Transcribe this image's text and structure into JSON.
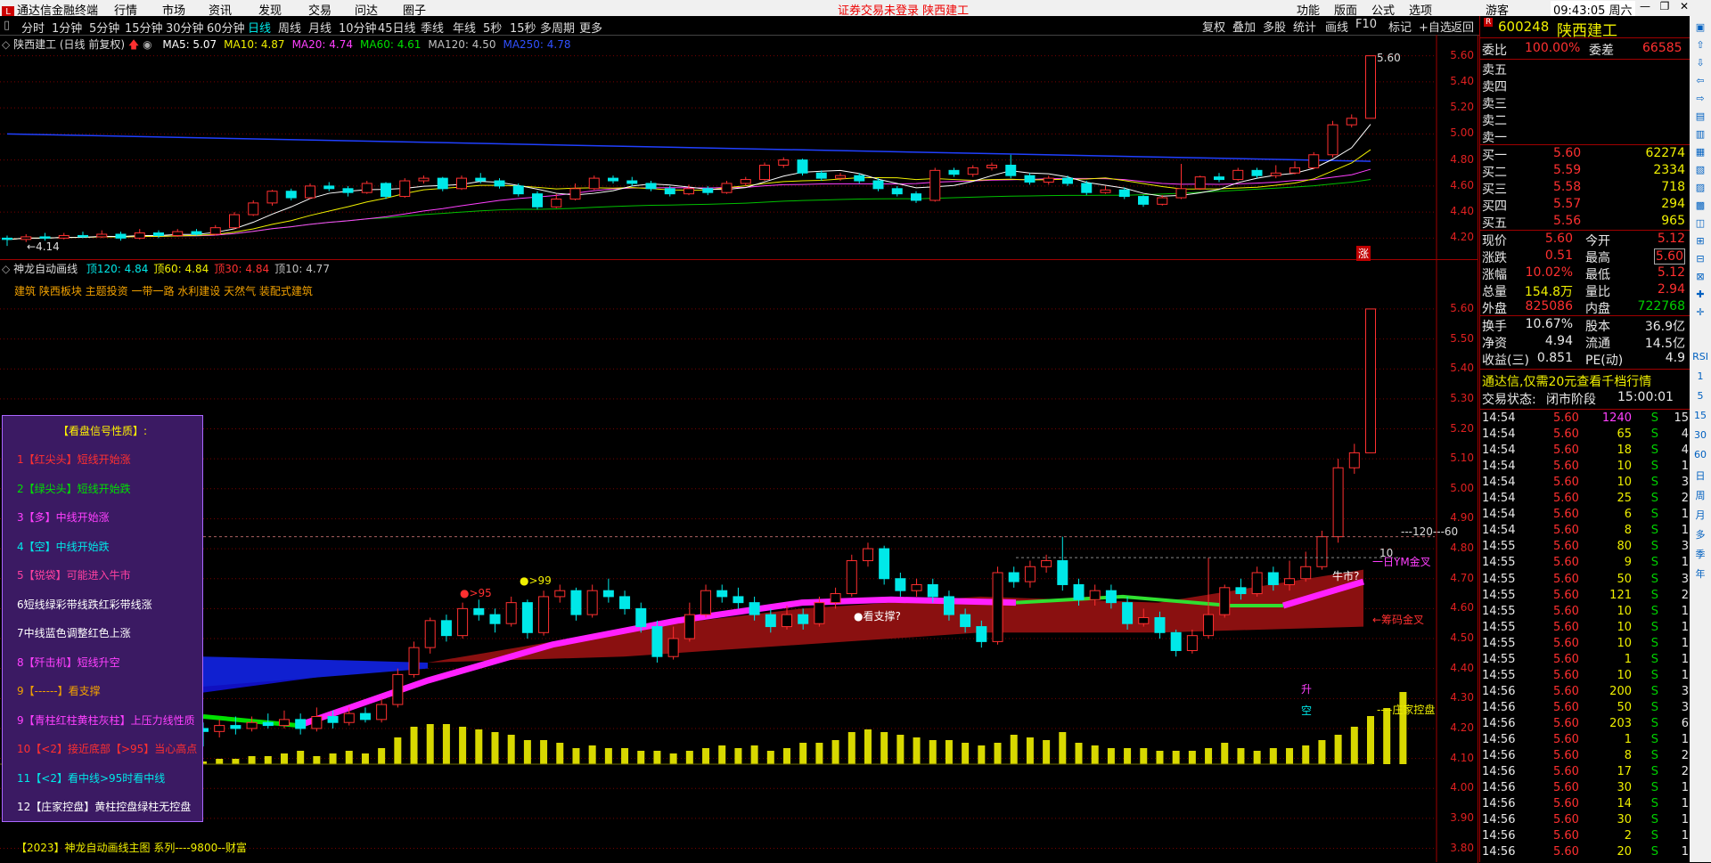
{
  "menubar": {
    "app_title": "通达信金融终端",
    "items": [
      "行情",
      "市场",
      "资讯",
      "发现",
      "交易",
      "问达",
      "圈子"
    ],
    "notice": "证券交易未登录  陕西建工",
    "right_items": [
      "功能",
      "版面",
      "公式",
      "选项"
    ],
    "user": "游客",
    "clock": "09:43:05 周六"
  },
  "toolbar": {
    "periods": [
      "分时",
      "1分钟",
      "5分钟",
      "15分钟",
      "30分钟",
      "60分钟",
      "日线",
      "周线",
      "月线",
      "10分钟",
      "45日线",
      "季线",
      "年线",
      "5秒",
      "15秒",
      "多周期",
      "更多"
    ],
    "selected": "日线",
    "right_buttons": [
      "复权",
      "叠加",
      "多股",
      "统计",
      "画线",
      "F10",
      "标记",
      "+自选",
      "返回"
    ]
  },
  "main_chart": {
    "title": "陕西建工 (日线 前复权)",
    "ma_labels": [
      {
        "text": "MA5: 5.07",
        "color": "#ffffff"
      },
      {
        "text": "MA10: 4.87",
        "color": "#f0f000"
      },
      {
        "text": "MA20: 4.74",
        "color": "#ff40ff"
      },
      {
        "text": "MA60: 4.61",
        "color": "#00e000"
      },
      {
        "text": "MA120: 4.50",
        "color": "#c0c0c0"
      },
      {
        "text": "MA250: 4.78",
        "color": "#3050ff"
      }
    ],
    "price_axis": [
      "5.60",
      "5.40",
      "5.20",
      "5.00",
      "4.80",
      "4.60",
      "4.40",
      "4.20"
    ],
    "high_label": "5.60",
    "low_label": "4.14",
    "limit_tag": "涨"
  },
  "sub_chart": {
    "title": "神龙自动画线",
    "indicators": [
      {
        "text": "顶120: 4.84",
        "color": "#00e8e8"
      },
      {
        "text": "顶60: 4.84",
        "color": "#f0f000"
      },
      {
        "text": "顶30: 4.84",
        "color": "#ff3030"
      },
      {
        "text": "顶10: 4.77",
        "color": "#c0c0c0"
      }
    ],
    "sectors": "建筑 陕西板块 主题投资 一带一路 水利建设 天然气 装配式建筑",
    "price_axis": [
      "5.60",
      "5.50",
      "5.40",
      "5.30",
      "5.20",
      "5.10",
      "5.00",
      "4.90",
      "4.80",
      "4.70",
      "4.60",
      "4.50",
      "4.40",
      "4.30",
      "4.20",
      "4.10",
      "4.00",
      "3.90",
      "3.80"
    ],
    "annotations": {
      "l120": "120",
      "l60": "60",
      "l10": "10",
      "ym": "一日YM金叉",
      "chip": "←筹码金叉",
      "control": "----庄家控盘",
      "niu": "牛市?",
      "rise": "升",
      "empty": "空",
      "support": "看支撑?",
      "p95": ">95",
      "p99": ">99"
    },
    "footer": "【2023】神龙自动画线主图 系列----9800--财富"
  },
  "legend": {
    "title": "【看盘信号性质】:",
    "items": [
      {
        "text": "1【红尖头】短线开始涨",
        "color": "#ff3030"
      },
      {
        "text": "2【绿尖头】短线开始跌",
        "color": "#00e000"
      },
      {
        "text": "3【多】中线开始涨",
        "color": "#ff40ff"
      },
      {
        "text": "4【空】中线开始跌",
        "color": "#00e8e8"
      },
      {
        "text": "5【锐袋】可能进入牛市",
        "color": "#ff40a0"
      },
      {
        "text": "6短线绿彩带线跌红彩带线涨",
        "color": "#ffffff"
      },
      {
        "text": "7中线蓝色调整红色上涨",
        "color": "#ffffff"
      },
      {
        "text": "8【歼击机】短线升空",
        "color": "#ff40ff"
      },
      {
        "text": "9【------】看支撑",
        "color": "#f0a000"
      },
      {
        "text": "9【青柱红柱黄柱灰柱】上压力线性质",
        "color": "#ff40ff"
      },
      {
        "text": "10【<2】接近底部【>95】当心高点",
        "color": "#ff3030"
      },
      {
        "text": "11【<2】看中线>95时看中线",
        "color": "#00e8e8"
      },
      {
        "text": "12【庄家控盘】黄柱控盘绿柱无控盘",
        "color": "#ffffff"
      }
    ]
  },
  "quote": {
    "code": "600248",
    "name": "陕西建工",
    "wb_label": "委比",
    "wb_value": "100.00%",
    "wc_label": "委差",
    "wc_value": "66585",
    "sells": [
      "卖五",
      "卖四",
      "卖三",
      "卖二",
      "卖一"
    ],
    "buys": [
      {
        "label": "买一",
        "price": "5.60",
        "vol": "62274"
      },
      {
        "label": "买二",
        "price": "5.59",
        "vol": "2334"
      },
      {
        "label": "买三",
        "price": "5.58",
        "vol": "718"
      },
      {
        "label": "买四",
        "price": "5.57",
        "vol": "294"
      },
      {
        "label": "买五",
        "price": "5.56",
        "vol": "965"
      }
    ],
    "stats": [
      {
        "l1": "现价",
        "v1": "5.60",
        "c1": "red",
        "l2": "今开",
        "v2": "5.12",
        "c2": "red"
      },
      {
        "l1": "涨跌",
        "v1": "0.51",
        "c1": "red",
        "l2": "最高",
        "v2": "5.60",
        "c2": "red"
      },
      {
        "l1": "涨幅",
        "v1": "10.02%",
        "c1": "red",
        "l2": "最低",
        "v2": "5.12",
        "c2": "red"
      },
      {
        "l1": "总量",
        "v1": "154.8万",
        "c1": "yel",
        "l2": "量比",
        "v2": "2.94",
        "c2": "red"
      },
      {
        "l1": "外盘",
        "v1": "825086",
        "c1": "red",
        "l2": "内盘",
        "v2": "722768",
        "c2": "grn"
      }
    ],
    "fund": [
      {
        "l1": "换手",
        "v1": "10.67%",
        "l2": "股本",
        "v2": "36.9亿"
      },
      {
        "l1": "净资",
        "v1": "4.94",
        "l2": "流通",
        "v2": "14.5亿"
      },
      {
        "l1": "收益(三)",
        "v1": "0.851",
        "l2": "PE(动)",
        "v2": "4.9"
      }
    ],
    "promo": "通达信,仅需20元查看千档行情",
    "status_label": "交易状态:",
    "status_value": "闭市阶段",
    "status_time": "15:00:01",
    "ticks": [
      {
        "t": "14:54",
        "p": "5.60",
        "v": "1240",
        "s": "S",
        "n": "15"
      },
      {
        "t": "14:54",
        "p": "5.60",
        "v": "65",
        "s": "S",
        "n": "4"
      },
      {
        "t": "14:54",
        "p": "5.60",
        "v": "18",
        "s": "S",
        "n": "4"
      },
      {
        "t": "14:54",
        "p": "5.60",
        "v": "10",
        "s": "S",
        "n": "1"
      },
      {
        "t": "14:54",
        "p": "5.60",
        "v": "10",
        "s": "S",
        "n": "3"
      },
      {
        "t": "14:54",
        "p": "5.60",
        "v": "25",
        "s": "S",
        "n": "2"
      },
      {
        "t": "14:54",
        "p": "5.60",
        "v": "6",
        "s": "S",
        "n": "1"
      },
      {
        "t": "14:54",
        "p": "5.60",
        "v": "8",
        "s": "S",
        "n": "1"
      },
      {
        "t": "14:55",
        "p": "5.60",
        "v": "80",
        "s": "S",
        "n": "3"
      },
      {
        "t": "14:55",
        "p": "5.60",
        "v": "9",
        "s": "S",
        "n": "1"
      },
      {
        "t": "14:55",
        "p": "5.60",
        "v": "50",
        "s": "S",
        "n": "3"
      },
      {
        "t": "14:55",
        "p": "5.60",
        "v": "121",
        "s": "S",
        "n": "2"
      },
      {
        "t": "14:55",
        "p": "5.60",
        "v": "10",
        "s": "S",
        "n": "1"
      },
      {
        "t": "14:55",
        "p": "5.60",
        "v": "10",
        "s": "S",
        "n": "1"
      },
      {
        "t": "14:55",
        "p": "5.60",
        "v": "10",
        "s": "S",
        "n": "1"
      },
      {
        "t": "14:55",
        "p": "5.60",
        "v": "1",
        "s": "S",
        "n": "1"
      },
      {
        "t": "14:55",
        "p": "5.60",
        "v": "10",
        "s": "S",
        "n": "1"
      },
      {
        "t": "14:56",
        "p": "5.60",
        "v": "200",
        "s": "S",
        "n": "3"
      },
      {
        "t": "14:56",
        "p": "5.60",
        "v": "50",
        "s": "S",
        "n": "3"
      },
      {
        "t": "14:56",
        "p": "5.60",
        "v": "203",
        "s": "S",
        "n": "6"
      },
      {
        "t": "14:56",
        "p": "5.60",
        "v": "1",
        "s": "S",
        "n": "1"
      },
      {
        "t": "14:56",
        "p": "5.60",
        "v": "8",
        "s": "S",
        "n": "2"
      },
      {
        "t": "14:56",
        "p": "5.60",
        "v": "17",
        "s": "S",
        "n": "2"
      },
      {
        "t": "14:56",
        "p": "5.60",
        "v": "30",
        "s": "S",
        "n": "1"
      },
      {
        "t": "14:56",
        "p": "5.60",
        "v": "14",
        "s": "S",
        "n": "1"
      },
      {
        "t": "14:56",
        "p": "5.60",
        "v": "30",
        "s": "S",
        "n": "1"
      },
      {
        "t": "14:56",
        "p": "5.60",
        "v": "2",
        "s": "S",
        "n": "1"
      },
      {
        "t": "14:56",
        "p": "5.60",
        "v": "20",
        "s": "S",
        "n": "1"
      }
    ]
  },
  "sidetool": [
    "RSI",
    "1",
    "5",
    "15",
    "30",
    "60",
    "日",
    "周",
    "月",
    "多",
    "季",
    "年"
  ],
  "candles": [
    [
      4.2,
      4.19,
      4.22,
      4.14
    ],
    [
      4.19,
      4.21,
      4.23,
      4.17
    ],
    [
      4.21,
      4.2,
      4.24,
      4.18
    ],
    [
      4.2,
      4.22,
      4.24,
      4.19
    ],
    [
      4.22,
      4.21,
      4.25,
      4.2
    ],
    [
      4.21,
      4.23,
      4.26,
      4.2
    ],
    [
      4.23,
      4.2,
      4.25,
      4.18
    ],
    [
      4.2,
      4.24,
      4.27,
      4.19
    ],
    [
      4.24,
      4.22,
      4.26,
      4.2
    ],
    [
      4.22,
      4.25,
      4.27,
      4.21
    ],
    [
      4.25,
      4.23,
      4.27,
      4.22
    ],
    [
      4.23,
      4.28,
      4.3,
      4.22
    ],
    [
      4.28,
      4.38,
      4.4,
      4.27
    ],
    [
      4.38,
      4.47,
      4.49,
      4.37
    ],
    [
      4.47,
      4.56,
      4.57,
      4.45
    ],
    [
      4.56,
      4.51,
      4.58,
      4.49
    ],
    [
      4.51,
      4.6,
      4.62,
      4.5
    ],
    [
      4.6,
      4.58,
      4.63,
      4.56
    ],
    [
      4.58,
      4.55,
      4.6,
      4.52
    ],
    [
      4.55,
      4.62,
      4.64,
      4.54
    ],
    [
      4.62,
      4.52,
      4.63,
      4.5
    ],
    [
      4.52,
      4.64,
      4.66,
      4.51
    ],
    [
      4.64,
      4.66,
      4.68,
      4.62
    ],
    [
      4.66,
      4.58,
      4.67,
      4.56
    ],
    [
      4.58,
      4.66,
      4.68,
      4.57
    ],
    [
      4.66,
      4.64,
      4.7,
      4.62
    ],
    [
      4.64,
      4.6,
      4.66,
      4.58
    ],
    [
      4.6,
      4.54,
      4.62,
      4.52
    ],
    [
      4.54,
      4.44,
      4.56,
      4.42
    ],
    [
      4.44,
      4.5,
      4.54,
      4.43
    ],
    [
      4.5,
      4.58,
      4.62,
      4.49
    ],
    [
      4.58,
      4.66,
      4.68,
      4.57
    ],
    [
      4.66,
      4.64,
      4.68,
      4.62
    ],
    [
      4.64,
      4.62,
      4.67,
      4.6
    ],
    [
      4.62,
      4.58,
      4.64,
      4.56
    ],
    [
      4.58,
      4.54,
      4.6,
      4.52
    ],
    [
      4.54,
      4.58,
      4.61,
      4.53
    ],
    [
      4.58,
      4.55,
      4.6,
      4.53
    ],
    [
      4.55,
      4.62,
      4.64,
      4.54
    ],
    [
      4.62,
      4.65,
      4.67,
      4.6
    ],
    [
      4.65,
      4.76,
      4.78,
      4.64
    ],
    [
      4.76,
      4.8,
      4.82,
      4.74
    ],
    [
      4.8,
      4.7,
      4.81,
      4.68
    ],
    [
      4.7,
      4.66,
      4.72,
      4.64
    ],
    [
      4.66,
      4.68,
      4.7,
      4.64
    ],
    [
      4.68,
      4.64,
      4.7,
      4.62
    ],
    [
      4.64,
      4.58,
      4.66,
      4.56
    ],
    [
      4.58,
      4.54,
      4.6,
      4.52
    ],
    [
      4.54,
      4.49,
      4.56,
      4.47
    ],
    [
      4.49,
      4.72,
      4.74,
      4.48
    ],
    [
      4.72,
      4.69,
      4.74,
      4.67
    ],
    [
      4.69,
      4.74,
      4.76,
      4.67
    ],
    [
      4.74,
      4.76,
      4.78,
      4.72
    ],
    [
      4.76,
      4.68,
      4.84,
      4.66
    ],
    [
      4.68,
      4.63,
      4.7,
      4.61
    ],
    [
      4.63,
      4.66,
      4.68,
      4.61
    ],
    [
      4.66,
      4.62,
      4.68,
      4.6
    ],
    [
      4.62,
      4.55,
      4.64,
      4.53
    ],
    [
      4.55,
      4.57,
      4.6,
      4.54
    ],
    [
      4.57,
      4.52,
      4.59,
      4.5
    ],
    [
      4.52,
      4.46,
      4.53,
      4.44
    ],
    [
      4.46,
      4.51,
      4.53,
      4.45
    ],
    [
      4.51,
      4.58,
      4.77,
      4.5
    ],
    [
      4.58,
      4.67,
      4.68,
      4.57
    ],
    [
      4.67,
      4.65,
      4.7,
      4.63
    ],
    [
      4.65,
      4.72,
      4.74,
      4.64
    ],
    [
      4.72,
      4.68,
      4.74,
      4.66
    ],
    [
      4.68,
      4.7,
      4.76,
      4.66
    ],
    [
      4.7,
      4.74,
      4.79,
      4.69
    ],
    [
      4.74,
      4.84,
      4.86,
      4.73
    ],
    [
      4.84,
      5.07,
      5.1,
      4.82
    ],
    [
      5.07,
      5.12,
      5.15,
      5.05
    ],
    [
      5.12,
      5.6,
      5.6,
      5.12
    ]
  ],
  "volumes": [
    1,
    2,
    2,
    3,
    3,
    4,
    5,
    3,
    4,
    5,
    4,
    6,
    10,
    14,
    15,
    15,
    14,
    13,
    12,
    11,
    9,
    9,
    8,
    6,
    7,
    6,
    6,
    5,
    5,
    4,
    5,
    6,
    7,
    6,
    7,
    5,
    6,
    8,
    8,
    9,
    12,
    13,
    12,
    11,
    10,
    9,
    9,
    8,
    7,
    8,
    11,
    10,
    9,
    12,
    8,
    7,
    6,
    6,
    6,
    5,
    5,
    5,
    6,
    8,
    6,
    5,
    6,
    6,
    7,
    9,
    11,
    14,
    18,
    21,
    27
  ],
  "colors": {
    "up": "#ff3030",
    "down": "#00e8e8",
    "bg": "#000000",
    "grid": "#7a0000"
  }
}
